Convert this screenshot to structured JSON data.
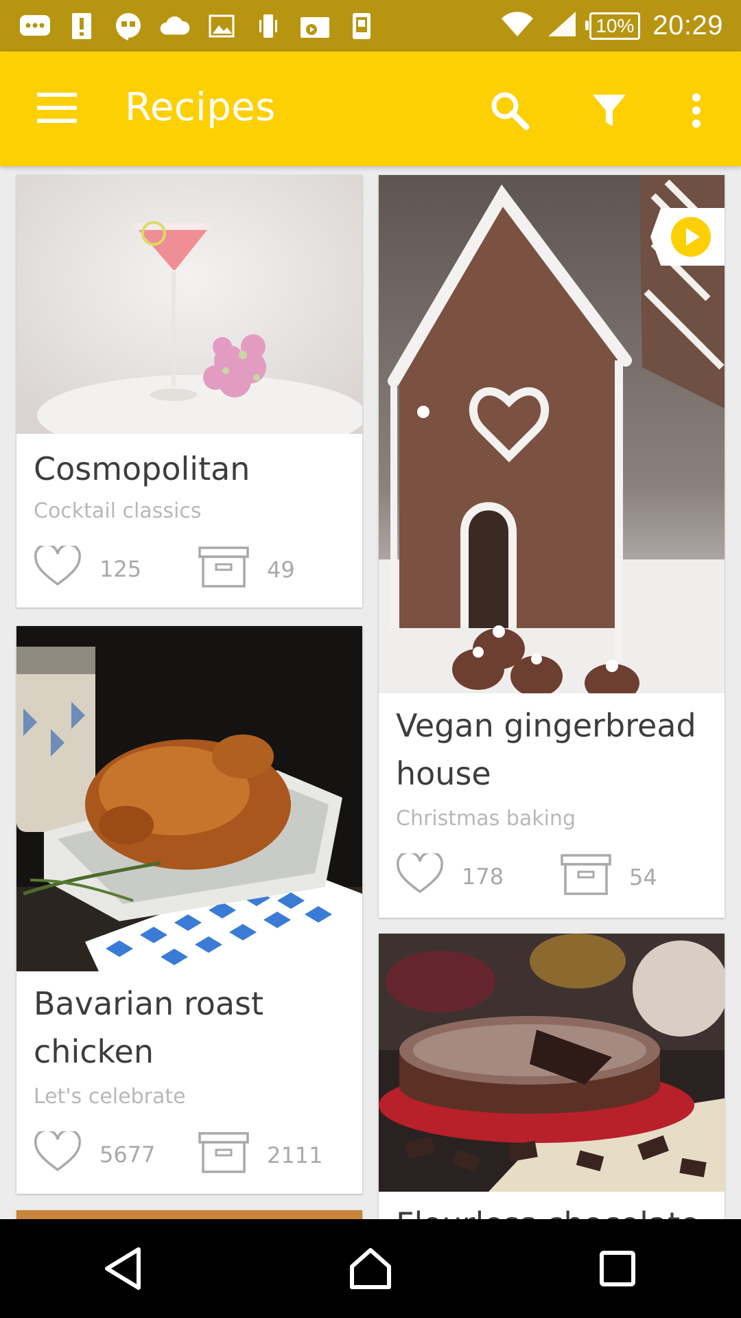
{
  "status_bar": {
    "icons": [
      "chat-bubble-icon",
      "alert-icon",
      "hangouts-icon",
      "cloud-icon",
      "image-icon",
      "phone-vibrate-icon",
      "video-icon",
      "tablet-icon"
    ],
    "battery": "10%",
    "time": "20:29"
  },
  "app_bar": {
    "title": "Recipes",
    "icons": [
      "menu-icon",
      "search-icon",
      "filter-icon",
      "more-vert-icon"
    ]
  },
  "recipes": [
    {
      "title": "Cosmopolitan",
      "category": "Cocktail classics",
      "likes": "125",
      "saves": "49"
    },
    {
      "title": "Vegan gingerbread house",
      "category": "Christmas baking",
      "likes": "178",
      "saves": "54",
      "has_video": true
    },
    {
      "title": "Bavarian roast chicken",
      "category": "Let's celebrate",
      "likes": "5677",
      "saves": "2111"
    },
    {
      "title": "Flourless chocolate",
      "category": "",
      "likes": "",
      "saves": ""
    }
  ],
  "nav_bar": {
    "buttons": [
      "back-icon",
      "home-icon",
      "recents-icon"
    ]
  },
  "colors": {
    "accent": "#fdd003",
    "status_bar": "#b89511"
  }
}
